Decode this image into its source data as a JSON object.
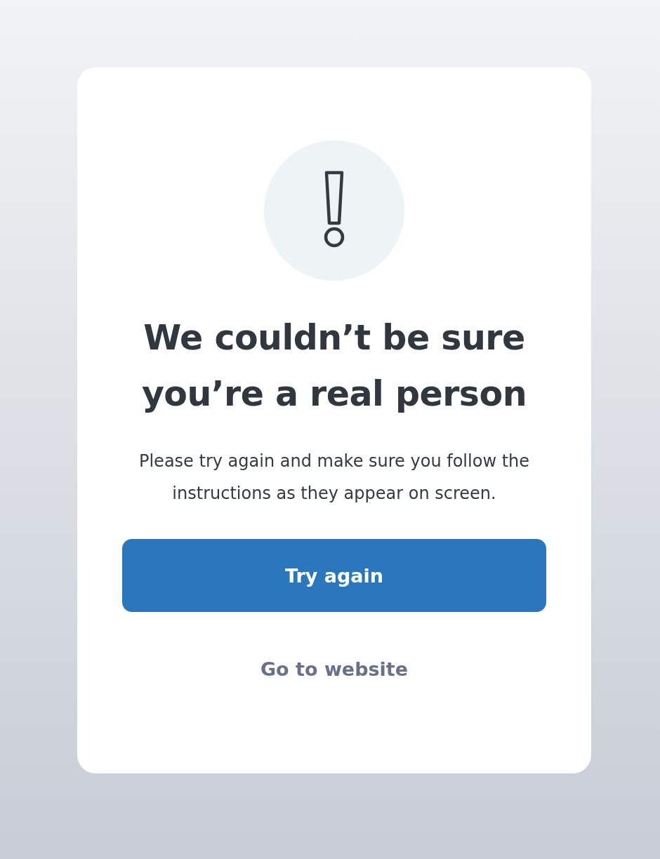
{
  "heading": "We couldn’t be sure you’re a real person",
  "message": "Please try again and make sure you follow the instructions as they appear on screen.",
  "primary_button": {
    "label": "Try again"
  },
  "secondary_link": {
    "label": "Go to website"
  }
}
